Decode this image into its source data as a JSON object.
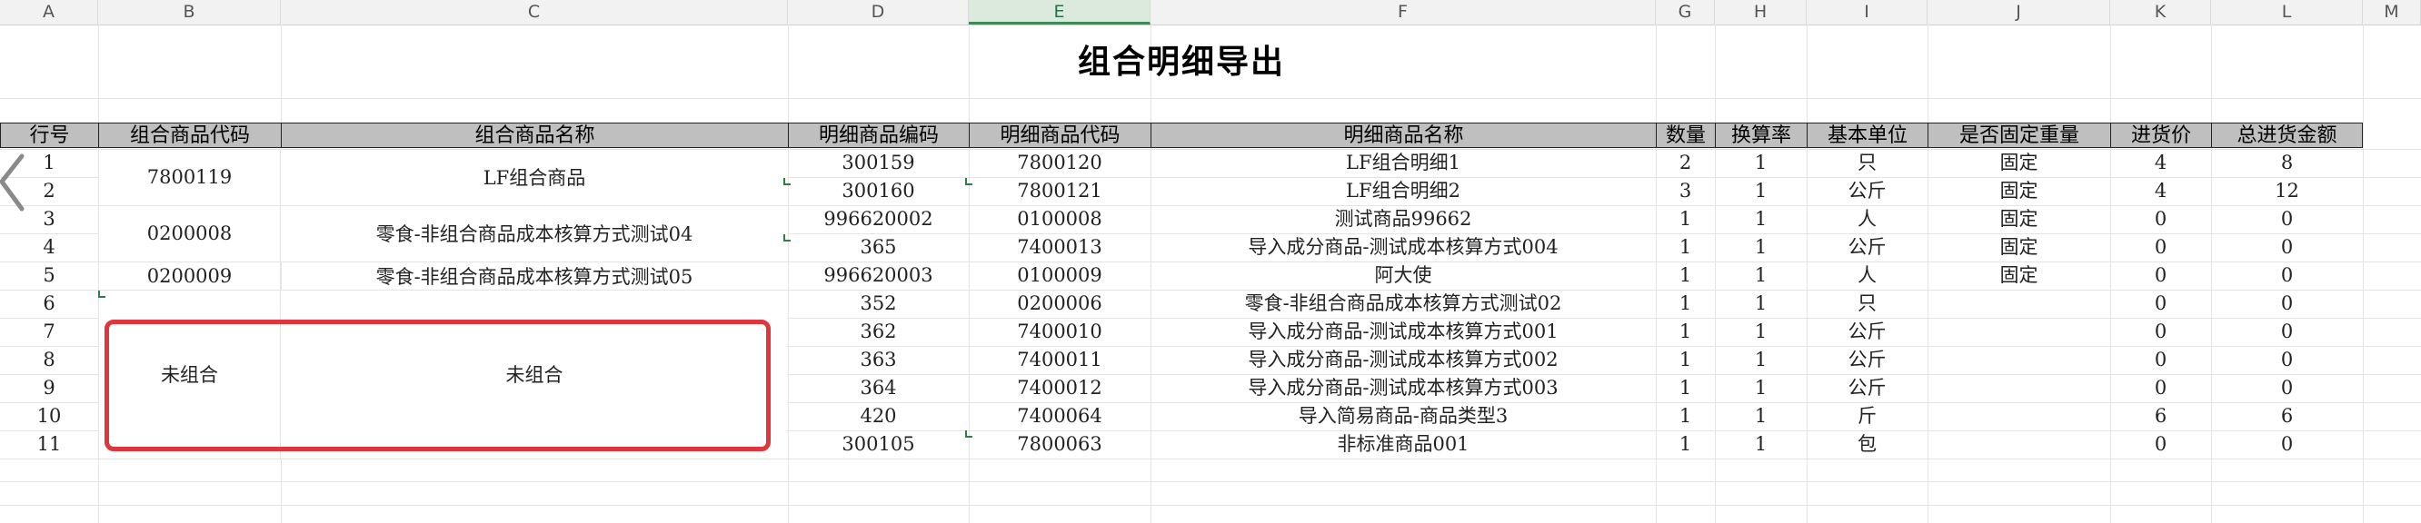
{
  "columns": [
    "A",
    "B",
    "C",
    "D",
    "E",
    "F",
    "G",
    "H",
    "I",
    "J",
    "K",
    "L",
    "M"
  ],
  "selected_column": "E",
  "sheet_title": "组合明细导出",
  "headers": [
    "行号",
    "组合商品代码",
    "组合商品名称",
    "明细商品编码",
    "明细商品代码",
    "明细商品名称",
    "数量",
    "换算率",
    "基本单位",
    "是否固定重量",
    "进货价",
    "总进货金额"
  ],
  "rows": [
    {
      "no": "1",
      "detail_code": "300159",
      "detail_id": "7800120",
      "detail_name": "LF组合明细1",
      "qty": "2",
      "rate": "1",
      "unit": "只",
      "fixed": "固定",
      "price": "4",
      "total": "8"
    },
    {
      "no": "2",
      "detail_code": "300160",
      "detail_id": "7800121",
      "detail_name": "LF组合明细2",
      "qty": "3",
      "rate": "1",
      "unit": "公斤",
      "fixed": "固定",
      "price": "4",
      "total": "12"
    },
    {
      "no": "3",
      "detail_code": "996620002",
      "detail_id": "0100008",
      "detail_name": "测试商品99662",
      "qty": "1",
      "rate": "1",
      "unit": "人",
      "fixed": "固定",
      "price": "0",
      "total": "0"
    },
    {
      "no": "4",
      "detail_code": "365",
      "detail_id": "7400013",
      "detail_name": "导入成分商品-测试成本核算方式004",
      "qty": "1",
      "rate": "1",
      "unit": "公斤",
      "fixed": "固定",
      "price": "0",
      "total": "0"
    },
    {
      "no": "5",
      "detail_code": "996620003",
      "detail_id": "0100009",
      "detail_name": "阿大使",
      "qty": "1",
      "rate": "1",
      "unit": "人",
      "fixed": "固定",
      "price": "0",
      "total": "0"
    },
    {
      "no": "6",
      "detail_code": "352",
      "detail_id": "0200006",
      "detail_name": "零食-非组合商品成本核算方式测试02",
      "qty": "1",
      "rate": "1",
      "unit": "只",
      "fixed": "",
      "price": "0",
      "total": "0"
    },
    {
      "no": "7",
      "detail_code": "362",
      "detail_id": "7400010",
      "detail_name": "导入成分商品-测试成本核算方式001",
      "qty": "1",
      "rate": "1",
      "unit": "公斤",
      "fixed": "",
      "price": "0",
      "total": "0"
    },
    {
      "no": "8",
      "detail_code": "363",
      "detail_id": "7400011",
      "detail_name": "导入成分商品-测试成本核算方式002",
      "qty": "1",
      "rate": "1",
      "unit": "公斤",
      "fixed": "",
      "price": "0",
      "total": "0"
    },
    {
      "no": "9",
      "detail_code": "364",
      "detail_id": "7400012",
      "detail_name": "导入成分商品-测试成本核算方式003",
      "qty": "1",
      "rate": "1",
      "unit": "公斤",
      "fixed": "",
      "price": "0",
      "total": "0"
    },
    {
      "no": "10",
      "detail_code": "420",
      "detail_id": "7400064",
      "detail_name": "导入简易商品-商品类型3",
      "qty": "1",
      "rate": "1",
      "unit": "斤",
      "fixed": "",
      "price": "6",
      "total": "6"
    },
    {
      "no": "11",
      "detail_code": "300105",
      "detail_id": "7800063",
      "detail_name": "非标准商品001",
      "qty": "1",
      "rate": "1",
      "unit": "包",
      "fixed": "",
      "price": "0",
      "total": "0"
    }
  ],
  "combos": [
    {
      "code": "7800119",
      "name": "LF组合商品"
    },
    {
      "code": "0200008",
      "name": "零食-非组合商品成本核算方式测试04"
    },
    {
      "code": "0200009",
      "name": "零食-非组合商品成本核算方式测试05"
    },
    {
      "code": "未组合",
      "name": "未组合"
    }
  ],
  "colors": {
    "header_fill": "#bfbfbf",
    "highlight": "#e0353b",
    "selection": "#217346"
  }
}
